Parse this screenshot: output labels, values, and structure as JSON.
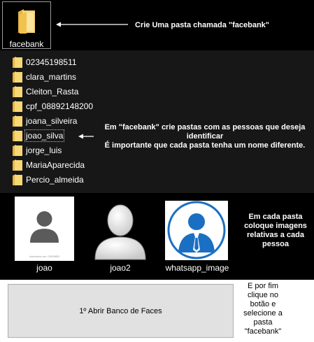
{
  "top": {
    "folder_label": "facebank",
    "instruction": "Crie Uma pasta chamada \"facebank\""
  },
  "folders": [
    "02345198511",
    "clara_martins",
    "Cleiton_Rasta",
    "cpf_08892148200",
    "joana_silveira",
    "joao_silva",
    "jorge_luis",
    "MariaAparecida",
    "Percio_almeida"
  ],
  "folders_note": {
    "line1": "Em \"facebank\" crie pastas com as pessoas que deseja",
    "line2": "identificar",
    "line3": "É importante que cada pasta tenha um nome diferente."
  },
  "images": {
    "items": [
      {
        "label": "joao",
        "caption": "shutterstock.com • 282998825"
      },
      {
        "label": "joao2"
      },
      {
        "label": "whatsapp_image"
      }
    ],
    "note": [
      "Em cada pasta",
      "coloque imagens",
      "relativas a cada",
      "pessoa"
    ]
  },
  "bottom": {
    "button_label": "1º Abrir Banco de Faces",
    "note": [
      "E por fim",
      "clique no",
      "botão e",
      "selecione a",
      "pasta",
      "\"facebank\""
    ]
  },
  "colors": {
    "folder_yellow": "#f8d775",
    "folder_dark": "#e4b445",
    "blue_avatar": "#1b6fc2"
  }
}
